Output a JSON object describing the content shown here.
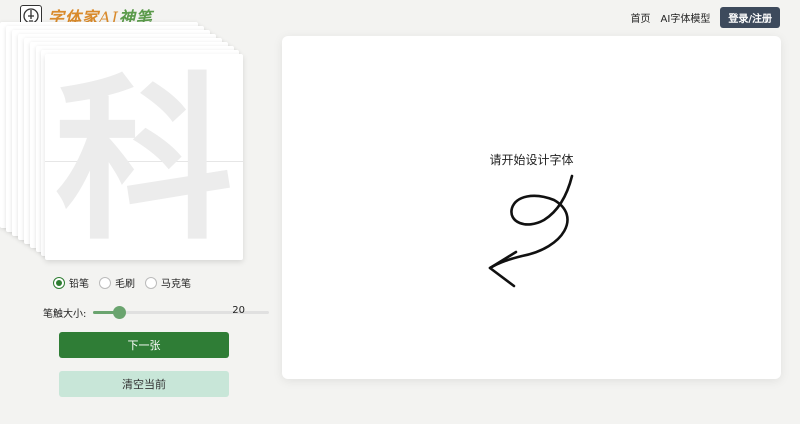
{
  "header": {
    "logo_text": "字体家",
    "logo_ai": "AI",
    "logo_tail": "神笔",
    "nav": [
      "首页",
      "AI字体模型"
    ],
    "login_label": "登录/注册"
  },
  "glyph_card": {
    "character": "科"
  },
  "tools": {
    "selected": "铅笔",
    "options": [
      "铅笔",
      "毛刷",
      "马克笔"
    ]
  },
  "brush_size": {
    "label": "笔触大小:",
    "value": "20",
    "level": 0.15
  },
  "buttons": {
    "next_label": "下一张",
    "clear_label": "清空当前"
  },
  "canvas": {
    "prompt": "请开始设计字体"
  },
  "colors": {
    "primary_green": "#2f7d36",
    "light_green": "#c8e6d8",
    "login_bg": "#3d4a5c",
    "logo_orange": "#d98a2b"
  }
}
